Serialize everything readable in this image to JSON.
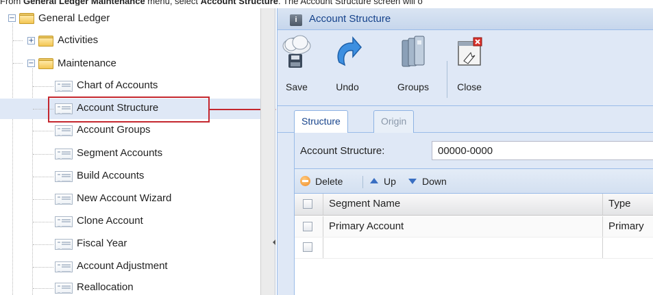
{
  "caption": {
    "pre": "From ",
    "menu": "General Ledger Maintenance",
    "mid": " menu, select ",
    "item": "Account Structure",
    "post": ". The Account Structure screen will o"
  },
  "tree": {
    "general_ledger": "General Ledger",
    "activities": "Activities",
    "maintenance": "Maintenance",
    "items": [
      "Chart of Accounts",
      "Account Structure",
      "Account Groups",
      "Segment Accounts",
      "Build Accounts",
      "New Account Wizard",
      "Clone Account",
      "Fiscal Year",
      "Account Adjustment",
      "Reallocation"
    ],
    "selected": "Account Structure"
  },
  "window": {
    "title": "Account Structure",
    "toolbar": {
      "save": "Save",
      "undo": "Undo",
      "groups": "Groups",
      "close": "Close"
    },
    "tabs": [
      "Structure",
      "Origin"
    ],
    "active_tab": "Structure",
    "form": {
      "account_structure_label": "Account Structure:",
      "account_structure_value": "00000-0000"
    },
    "grid_toolbar": {
      "delete": "Delete",
      "up": "Up",
      "down": "Down"
    },
    "grid": {
      "columns": [
        "Segment Name",
        "Type"
      ],
      "rows": [
        {
          "segment_name": "Primary Account",
          "type": "Primary"
        },
        {
          "segment_name": "",
          "type": ""
        }
      ]
    }
  },
  "colors": {
    "selection": "#dfe8f6",
    "highlight_border": "#c4262e",
    "panel_bg": "#dfe8f6",
    "title_text": "#15428b"
  }
}
